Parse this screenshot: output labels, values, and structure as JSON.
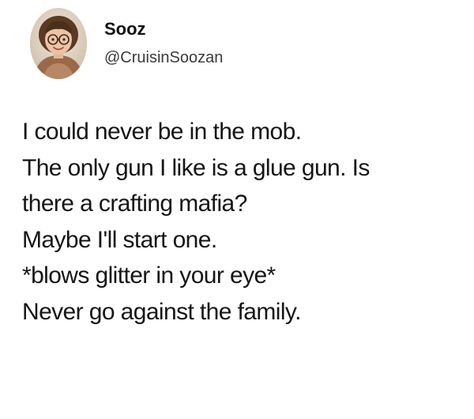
{
  "tweet": {
    "author": {
      "display_name": "Sooz",
      "handle": "@CruisinSoozan",
      "avatar_icon": "profile-photo-icon"
    },
    "lines": [
      "I could never be in the mob.",
      "The only gun I like is a glue gun. Is",
      "there a crafting mafia?",
      "Maybe I'll start one.",
      "*blows glitter in your eye*",
      "Never go against the family."
    ]
  },
  "colors": {
    "background": "#ffffff",
    "text": "#151515",
    "handle": "#3a3a3a"
  }
}
